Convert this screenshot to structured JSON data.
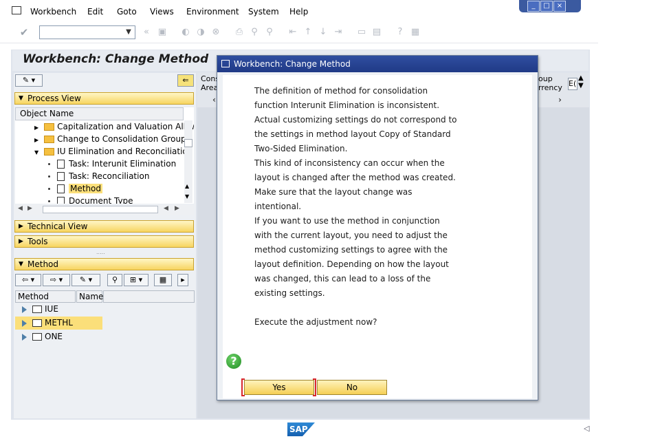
{
  "menu": [
    "Workbench",
    "Edit",
    "Goto",
    "Views",
    "Environment",
    "System",
    "Help"
  ],
  "app_title": "Workbench: Change Method",
  "left_panel": {
    "process_view": "Process View",
    "object_name_header": "Object Name",
    "tree": [
      "Capitalization and Valuation Allowa",
      "Change to Consolidation Group",
      "IU Elimination and Reconciliation",
      "Task: Interunit Elimination",
      "Task: Reconciliation",
      "Method",
      "Document Type"
    ],
    "technical_view": "Technical View",
    "tools": "Tools",
    "method_section": "Method",
    "list_headers": [
      "Method",
      "Name"
    ],
    "methods": [
      "IUE",
      "METHL",
      "ONE"
    ]
  },
  "right_panel": {
    "cons_label": "Cons",
    "area_label": "Area",
    "group_label": "oup",
    "currency_label": "rrency",
    "currency_value": "E("
  },
  "dialog": {
    "title": "Workbench: Change Method",
    "lines": [
      "The definition of method for consolidation",
      "function Interunit Elimination is inconsistent.",
      "Actual customizing settings do not correspond to",
      "the settings in method layout Copy of Standard",
      "Two-Sided Elimination.",
      "This kind of inconsistency can occur when the",
      "layout is changed after the method was created.",
      "Make sure that the layout change was",
      "intentional.",
      "If you want to use the method in conjunction",
      "with the current layout, you need to adjust the",
      "method customizing settings to agree with the",
      "layout definition. Depending on how the layout",
      "was changed, this can lead to a loss of the",
      "existing settings."
    ],
    "question": "Execute the adjustment now?",
    "yes": "Yes",
    "no": "No"
  },
  "footer": {
    "logo": "SAP"
  },
  "colors": {
    "accent_blue": "#203a86",
    "button_yellow": "#f5cf55",
    "focus_red": "#d8262c"
  }
}
